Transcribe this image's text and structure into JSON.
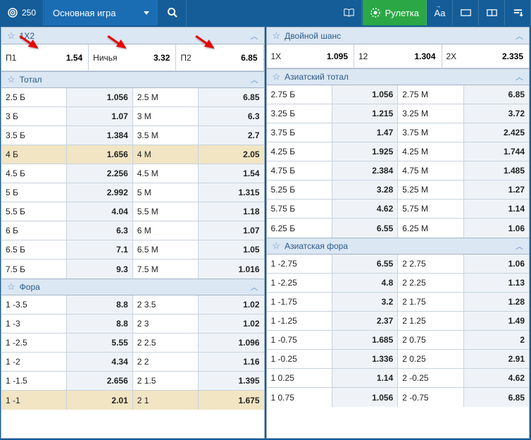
{
  "header": {
    "counter": "250",
    "dropdown_label": "Основная игра",
    "roulette_label": "Рулетка",
    "aa_label": "Aa"
  },
  "sections": {
    "s_1x2": {
      "title": "1X2",
      "p1_label": "П1",
      "p1_odds": "1.54",
      "draw_label": "Ничья",
      "draw_odds": "3.32",
      "p2_label": "П2",
      "p2_odds": "6.85"
    },
    "total": {
      "title": "Тотал",
      "rows": [
        {
          "l1": "2.5 Б",
          "o1": "1.056",
          "l2": "2.5 М",
          "o2": "6.85"
        },
        {
          "l1": "3 Б",
          "o1": "1.07",
          "l2": "3 М",
          "o2": "6.3"
        },
        {
          "l1": "3.5 Б",
          "o1": "1.384",
          "l2": "3.5 М",
          "o2": "2.7"
        },
        {
          "l1": "4 Б",
          "o1": "1.656",
          "l2": "4 М",
          "o2": "2.05",
          "hl": true
        },
        {
          "l1": "4.5 Б",
          "o1": "2.256",
          "l2": "4.5 М",
          "o2": "1.54"
        },
        {
          "l1": "5 Б",
          "o1": "2.992",
          "l2": "5 М",
          "o2": "1.315"
        },
        {
          "l1": "5.5 Б",
          "o1": "4.04",
          "l2": "5.5 М",
          "o2": "1.18"
        },
        {
          "l1": "6 Б",
          "o1": "6.3",
          "l2": "6 М",
          "o2": "1.07"
        },
        {
          "l1": "6.5 Б",
          "o1": "7.1",
          "l2": "6.5 М",
          "o2": "1.05"
        },
        {
          "l1": "7.5 Б",
          "o1": "9.3",
          "l2": "7.5 М",
          "o2": "1.016"
        }
      ]
    },
    "fora": {
      "title": "Фора",
      "rows": [
        {
          "l1": "1 -3.5",
          "o1": "8.8",
          "l2": "2 3.5",
          "o2": "1.02"
        },
        {
          "l1": "1 -3",
          "o1": "8.8",
          "l2": "2 3",
          "o2": "1.02"
        },
        {
          "l1": "1 -2.5",
          "o1": "5.55",
          "l2": "2 2.5",
          "o2": "1.096"
        },
        {
          "l1": "1 -2",
          "o1": "4.34",
          "l2": "2 2",
          "o2": "1.16"
        },
        {
          "l1": "1 -1.5",
          "o1": "2.656",
          "l2": "2 1.5",
          "o2": "1.395"
        },
        {
          "l1": "1 -1",
          "o1": "2.01",
          "l2": "2 1",
          "o2": "1.675",
          "hl": true
        }
      ]
    },
    "double_chance": {
      "title": "Двойной шанс",
      "c1_label": "1X",
      "c1_odds": "1.095",
      "c2_label": "12",
      "c2_odds": "1.304",
      "c3_label": "2X",
      "c3_odds": "2.335"
    },
    "asian_total": {
      "title": "Азиатский тотал",
      "rows": [
        {
          "l1": "2.75 Б",
          "o1": "1.056",
          "l2": "2.75 М",
          "o2": "6.85"
        },
        {
          "l1": "3.25 Б",
          "o1": "1.215",
          "l2": "3.25 М",
          "o2": "3.72"
        },
        {
          "l1": "3.75 Б",
          "o1": "1.47",
          "l2": "3.75 М",
          "o2": "2.425"
        },
        {
          "l1": "4.25 Б",
          "o1": "1.925",
          "l2": "4.25 М",
          "o2": "1.744"
        },
        {
          "l1": "4.75 Б",
          "o1": "2.384",
          "l2": "4.75 М",
          "o2": "1.485"
        },
        {
          "l1": "5.25 Б",
          "o1": "3.28",
          "l2": "5.25 М",
          "o2": "1.27"
        },
        {
          "l1": "5.75 Б",
          "o1": "4.62",
          "l2": "5.75 М",
          "o2": "1.14"
        },
        {
          "l1": "6.25 Б",
          "o1": "6.55",
          "l2": "6.25 М",
          "o2": "1.06"
        }
      ]
    },
    "asian_fora": {
      "title": "Азиатская фора",
      "rows": [
        {
          "l1": "1 -2.75",
          "o1": "6.55",
          "l2": "2 2.75",
          "o2": "1.06"
        },
        {
          "l1": "1 -2.25",
          "o1": "4.8",
          "l2": "2 2.25",
          "o2": "1.13"
        },
        {
          "l1": "1 -1.75",
          "o1": "3.2",
          "l2": "2 1.75",
          "o2": "1.28"
        },
        {
          "l1": "1 -1.25",
          "o1": "2.37",
          "l2": "2 1.25",
          "o2": "1.49"
        },
        {
          "l1": "1 -0.75",
          "o1": "1.685",
          "l2": "2 0.75",
          "o2": "2"
        },
        {
          "l1": "1 -0.25",
          "o1": "1.336",
          "l2": "2 0.25",
          "o2": "2.91"
        },
        {
          "l1": "1 0.25",
          "o1": "1.14",
          "l2": "2 -0.25",
          "o2": "4.62"
        },
        {
          "l1": "1 0.75",
          "o1": "1.056",
          "l2": "2 -0.75",
          "o2": "6.85"
        }
      ]
    }
  }
}
